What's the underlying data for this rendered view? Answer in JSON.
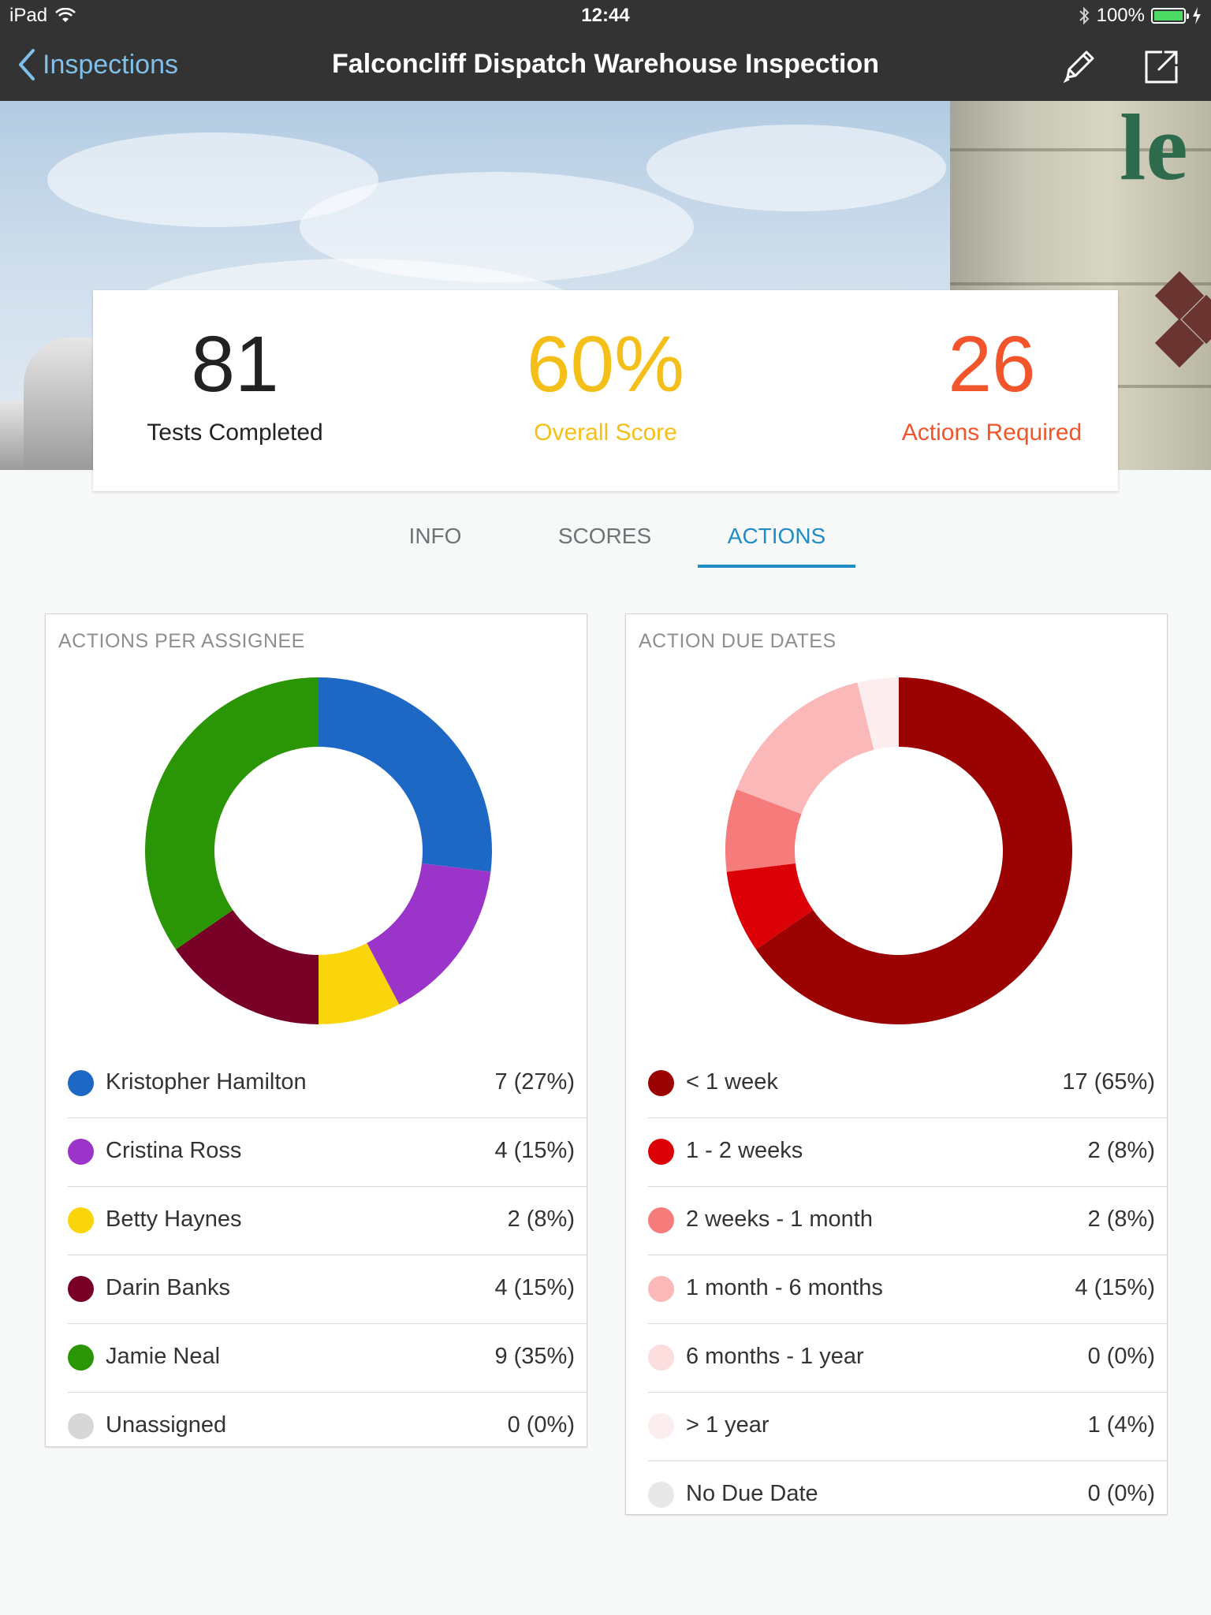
{
  "status_bar": {
    "device": "iPad",
    "time": "12:44",
    "battery": "100%"
  },
  "nav": {
    "back_label": "Inspections",
    "title": "Falconcliff Dispatch Warehouse Inspection"
  },
  "stats": {
    "tests_completed": {
      "value": "81",
      "label": "Tests Completed"
    },
    "overall_score": {
      "value": "60%",
      "label": "Overall Score"
    },
    "actions_required": {
      "value": "26",
      "label": "Actions Required"
    }
  },
  "colors": {
    "score": "#f5bf1a",
    "actions": "#f2552c",
    "tab_active": "#1f8dc4"
  },
  "tabs": [
    {
      "label": "INFO"
    },
    {
      "label": "SCORES"
    },
    {
      "label": "ACTIONS"
    }
  ],
  "active_tab": "ACTIONS",
  "chart_data": [
    {
      "type": "pie",
      "title": "ACTIONS PER ASSIGNEE",
      "categories": [
        "Kristopher Hamilton",
        "Cristina Ross",
        "Betty Haynes",
        "Darin Banks",
        "Jamie Neal",
        "Unassigned"
      ],
      "values": [
        7,
        4,
        2,
        4,
        9,
        0
      ],
      "labels": [
        "7 (27%)",
        "4 (15%)",
        "2 (8%)",
        "4 (15%)",
        "9 (35%)",
        "0 (0%)"
      ],
      "colors": [
        "#1c68c4",
        "#9b34c8",
        "#fbd50c",
        "#780026",
        "#2a9605",
        "#d7d7d7"
      ]
    },
    {
      "type": "pie",
      "title": "ACTION DUE DATES",
      "categories": [
        "< 1 week",
        "1 - 2 weeks",
        "2 weeks - 1 month",
        "1 month - 6 months",
        "6 months - 1 year",
        "> 1 year",
        "No Due Date"
      ],
      "values": [
        17,
        2,
        2,
        4,
        0,
        1,
        0
      ],
      "labels": [
        "17 (65%)",
        "2 (8%)",
        "2 (8%)",
        "4 (15%)",
        "0 (0%)",
        "1 (4%)",
        "0 (0%)"
      ],
      "colors": [
        "#9b0202",
        "#dc0106",
        "#f67b7b",
        "#fbb8b8",
        "#fcdede",
        "#fceeee",
        "#e8e8e8"
      ]
    }
  ]
}
